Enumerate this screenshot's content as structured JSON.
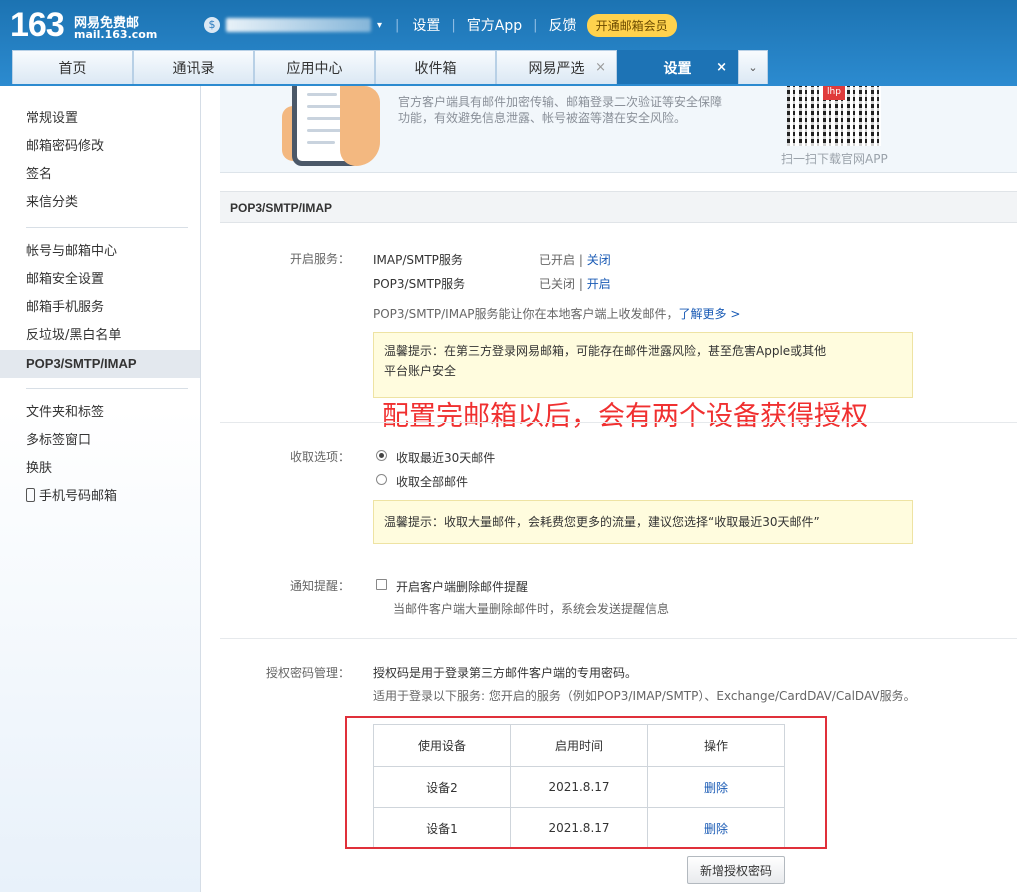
{
  "header": {
    "logo_number": "163",
    "logo_cn": "网易免费邮",
    "logo_url": "mail.163.com",
    "user_glyph": "$",
    "links": [
      "设置",
      "官方App",
      "反馈"
    ],
    "vip_label": "开通邮箱会员"
  },
  "tabs": [
    {
      "label": "首页",
      "closable": false,
      "active": false
    },
    {
      "label": "通讯录",
      "closable": false,
      "active": false
    },
    {
      "label": "应用中心",
      "closable": false,
      "active": false
    },
    {
      "label": "收件箱",
      "closable": false,
      "active": false
    },
    {
      "label": "网易严选",
      "closable": true,
      "active": false
    },
    {
      "label": "设置",
      "closable": true,
      "active": true
    }
  ],
  "sidebar": {
    "group1": [
      "常规设置",
      "邮箱密码修改",
      "签名",
      "来信分类"
    ],
    "group2": [
      "帐号与邮箱中心",
      "邮箱安全设置",
      "邮箱手机服务",
      "反垃圾/黑白名单",
      "POP3/SMTP/IMAP"
    ],
    "group3": [
      "文件夹和标签",
      "多标签窗口",
      "换肤",
      "手机号码邮箱"
    ]
  },
  "banner": {
    "text": "官方客户端具有邮件加密传输、邮箱登录二次验证等安全保障功能，有效避免信息泄露、帐号被盗等潜在安全风险。",
    "qr_logo": "lhp",
    "qr_caption": "扫一扫下载官网APP"
  },
  "section_title": "POP3/SMTP/IMAP",
  "services": {
    "label": "开启服务：",
    "rows": [
      {
        "name": "IMAP/SMTP服务",
        "status": "已开启",
        "action": "关闭"
      },
      {
        "name": "POP3/SMTP服务",
        "status": "已关闭",
        "action": "开启"
      }
    ],
    "desc": "POP3/SMTP/IMAP服务能让你在本地客户端上收发邮件，",
    "learn_more": "了解更多 >",
    "notice_line1": "温馨提示：在第三方登录网易邮箱，可能存在邮件泄露风险，甚至危害Apple或其他",
    "notice_line2": "平台账户安全"
  },
  "annotation": "配置完邮箱以后，会有两个设备获得授权",
  "receive": {
    "label": "收取选项：",
    "options": [
      {
        "label": "收取最近30天邮件",
        "checked": true
      },
      {
        "label": "收取全部邮件",
        "checked": false
      }
    ],
    "notice": "温馨提示：收取大量邮件，会耗费您更多的流量，建议您选择“收取最近30天邮件”"
  },
  "notify": {
    "label": "通知提醒：",
    "checkbox_label": "开启客户端删除邮件提醒",
    "checked": false,
    "sub": "当邮件客户端大量删除邮件时，系统会发送提醒信息"
  },
  "auth": {
    "label": "授权密码管理：",
    "line1": "授权码是用于登录第三方邮件客户端的专用密码。",
    "line2": "适用于登录以下服务: 您开启的服务（例如POP3/IMAP/SMTP）、Exchange/CardDAV/CalDAV服务。",
    "columns": [
      "使用设备",
      "启用时间",
      "操作"
    ],
    "rows": [
      {
        "device": "设备2",
        "date": "2021.8.17",
        "action": "删除"
      },
      {
        "device": "设备1",
        "date": "2021.8.17",
        "action": "删除"
      }
    ],
    "new_button": "新增授权密码"
  }
}
